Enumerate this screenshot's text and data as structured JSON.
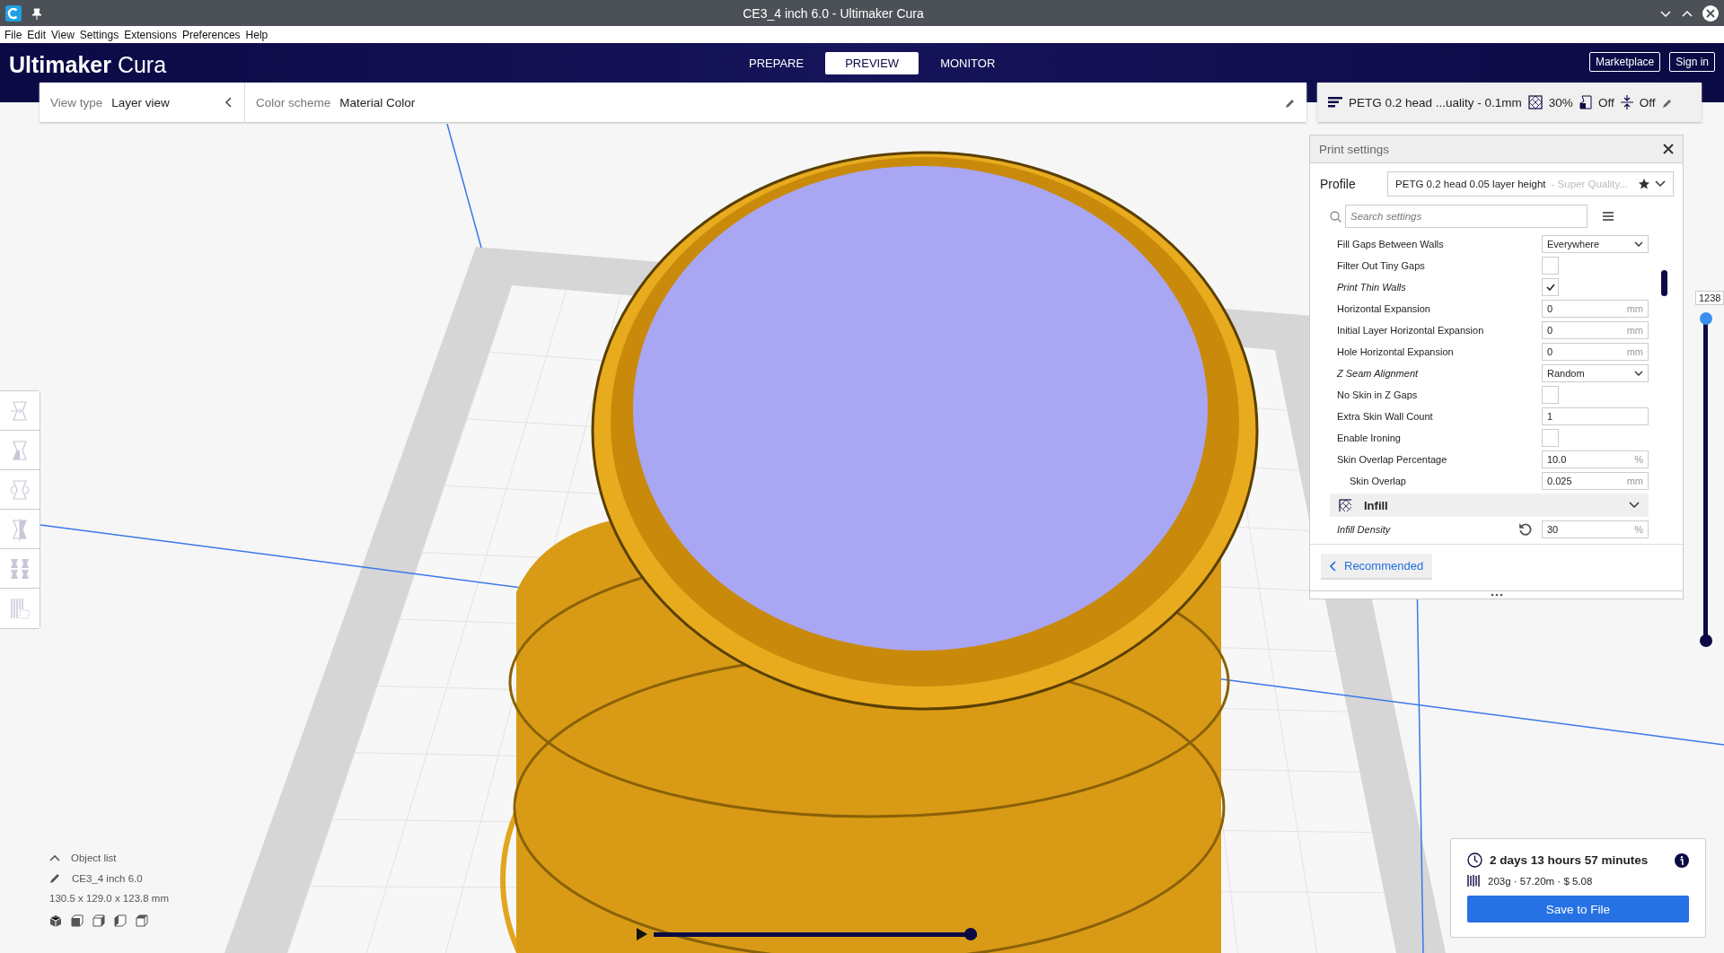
{
  "window": {
    "title": "CE3_4 inch 6.0 - Ultimaker Cura"
  },
  "menu": [
    {
      "label": "File"
    },
    {
      "label": "Edit"
    },
    {
      "label": "View"
    },
    {
      "label": "Settings"
    },
    {
      "label": "Extensions"
    },
    {
      "label": "Preferences"
    },
    {
      "label": "Help"
    }
  ],
  "app": {
    "logo_bold": "Ultimaker",
    "logo_light": "Cura"
  },
  "stages": [
    {
      "label": "PREPARE",
      "selected": false
    },
    {
      "label": "PREVIEW",
      "selected": true
    },
    {
      "label": "MONITOR",
      "selected": false
    }
  ],
  "header_buttons": [
    "Marketplace",
    "Sign in"
  ],
  "view_type": {
    "label": "View type",
    "value": "Layer view"
  },
  "color_scheme": {
    "label": "Color scheme",
    "value": "Material Color"
  },
  "print_summary": {
    "profile": "PETG 0.2 head ...uality - 0.1mm",
    "infill": "30%",
    "support": "Off",
    "adhesion": "Off"
  },
  "print_settings": {
    "title": "Print settings",
    "profile_label": "Profile",
    "profile_name": "PETG 0.2 head 0.05 layer height",
    "profile_quality": "- Super Quality...",
    "search_placeholder": "Search settings",
    "mode_button": "Recommended",
    "settings": [
      {
        "kind": "dropdown",
        "label": "Fill Gaps Between Walls",
        "value": "Everywhere",
        "overridden": false,
        "resettable": false
      },
      {
        "kind": "checkbox",
        "label": "Filter Out Tiny Gaps",
        "checked": false,
        "overridden": false,
        "resettable": false
      },
      {
        "kind": "checkbox",
        "label": "Print Thin Walls",
        "checked": true,
        "overridden": true,
        "resettable": false
      },
      {
        "kind": "number",
        "label": "Horizontal Expansion",
        "value": "0",
        "unit": "mm",
        "overridden": false,
        "resettable": false
      },
      {
        "kind": "number",
        "label": "Initial Layer Horizontal Expansion",
        "value": "0",
        "unit": "mm",
        "overridden": false,
        "resettable": false
      },
      {
        "kind": "number",
        "label": "Hole Horizontal Expansion",
        "value": "0",
        "unit": "mm",
        "overridden": false,
        "resettable": false
      },
      {
        "kind": "dropdown",
        "label": "Z Seam Alignment",
        "value": "Random",
        "overridden": true,
        "resettable": false
      },
      {
        "kind": "checkbox",
        "label": "No Skin in Z Gaps",
        "checked": false,
        "overridden": false,
        "resettable": false
      },
      {
        "kind": "number",
        "label": "Extra Skin Wall Count",
        "value": "1",
        "overridden": false,
        "resettable": false
      },
      {
        "kind": "checkbox",
        "label": "Enable Ironing",
        "checked": false,
        "overridden": false,
        "resettable": false
      },
      {
        "kind": "number",
        "label": "Skin Overlap Percentage",
        "value": "10.0",
        "unit": "%",
        "overridden": false,
        "resettable": false,
        "children": [
          {
            "kind": "number",
            "label": "Skin Overlap",
            "value": "0.025",
            "unit": "mm",
            "overridden": false,
            "resettable": false
          }
        ]
      },
      {
        "kind": "category",
        "label": "Infill"
      },
      {
        "kind": "number",
        "label": "Infill Density",
        "value": "30",
        "unit": "%",
        "overridden": true,
        "resettable": true
      }
    ]
  },
  "layer_slider": {
    "label": "1238",
    "level": 1
  },
  "object_list": {
    "title": "Object list",
    "object": "CE3_4 inch 6.0",
    "dimensions": "130.5 x 129.0 x 123.8 mm"
  },
  "estimate": {
    "time": "2 days 13 hours 57 minutes",
    "material": "203g · 57.20m · $ 5.08",
    "button": "Save to File"
  },
  "playback": {
    "level": 1
  }
}
